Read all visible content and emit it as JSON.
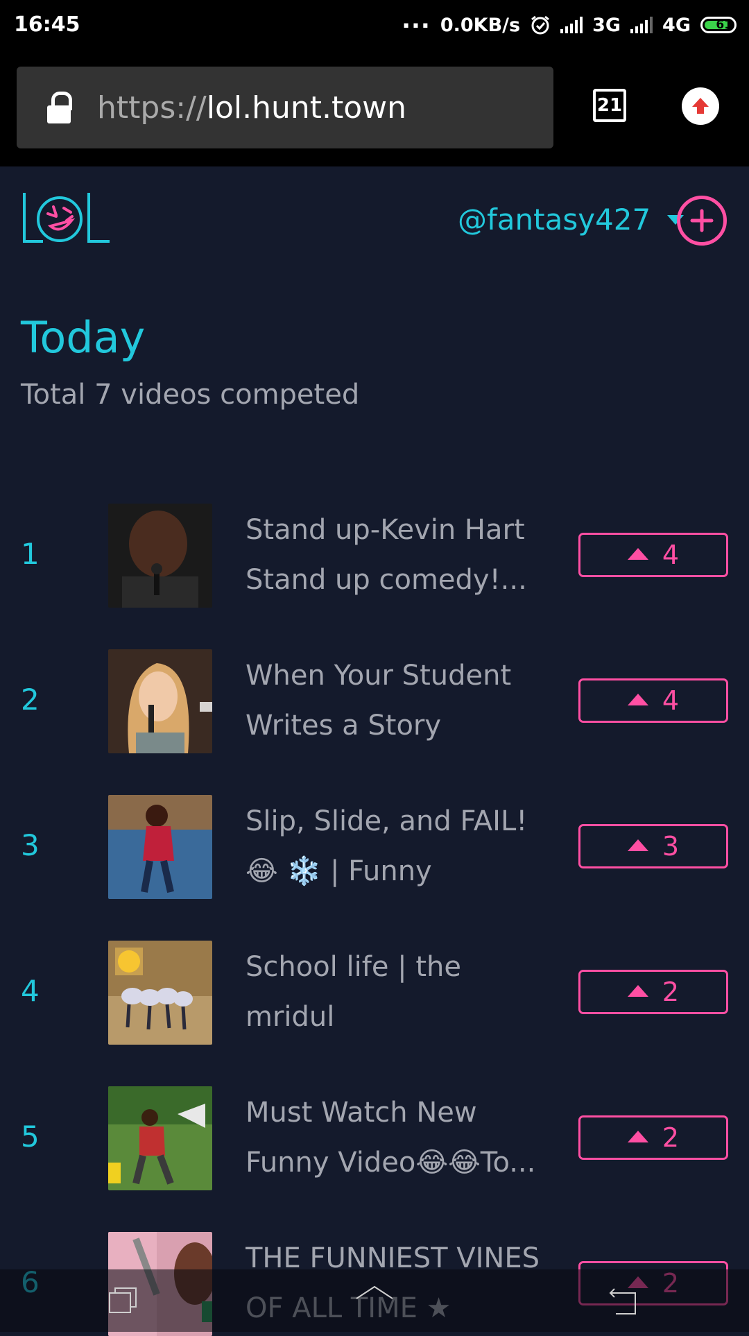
{
  "status_bar": {
    "time": "16:45",
    "dots": "...",
    "speed": "0.0KB/s",
    "alarm_icon": "alarm-clock-icon",
    "net1": "3G",
    "net2": "4G",
    "battery": "61"
  },
  "browser": {
    "url_scheme": "https://",
    "url_host": "lol.hunt.town",
    "tab_count": "21",
    "accent": "#e53935"
  },
  "header": {
    "username": "@fantasy427",
    "accent_cyan": "#22c8dc",
    "accent_pink": "#ff4fa3"
  },
  "page": {
    "title": "Today",
    "subtitle": "Total 7 videos competed"
  },
  "videos": [
    {
      "rank": "1",
      "title": "Stand up-Kevin Hart\nStand up comedy!...",
      "votes": "4"
    },
    {
      "rank": "2",
      "title": "When Your Student\nWrites a Story About...",
      "votes": "4"
    },
    {
      "rank": "3",
      "title": "Slip, Slide, and FAIL!\n😂 ❄️ | Funny Videos...",
      "votes": "3"
    },
    {
      "rank": "4",
      "title": "School life | the mridul\n| pragati | nitin",
      "votes": "2"
    },
    {
      "rank": "5",
      "title": "Must Watch New\nFunny Video😂😂To...",
      "votes": "2"
    },
    {
      "rank": "6",
      "title": "THE FUNNIEST VINES\nOF ALL TIME ★ Best...",
      "votes": "2"
    }
  ]
}
